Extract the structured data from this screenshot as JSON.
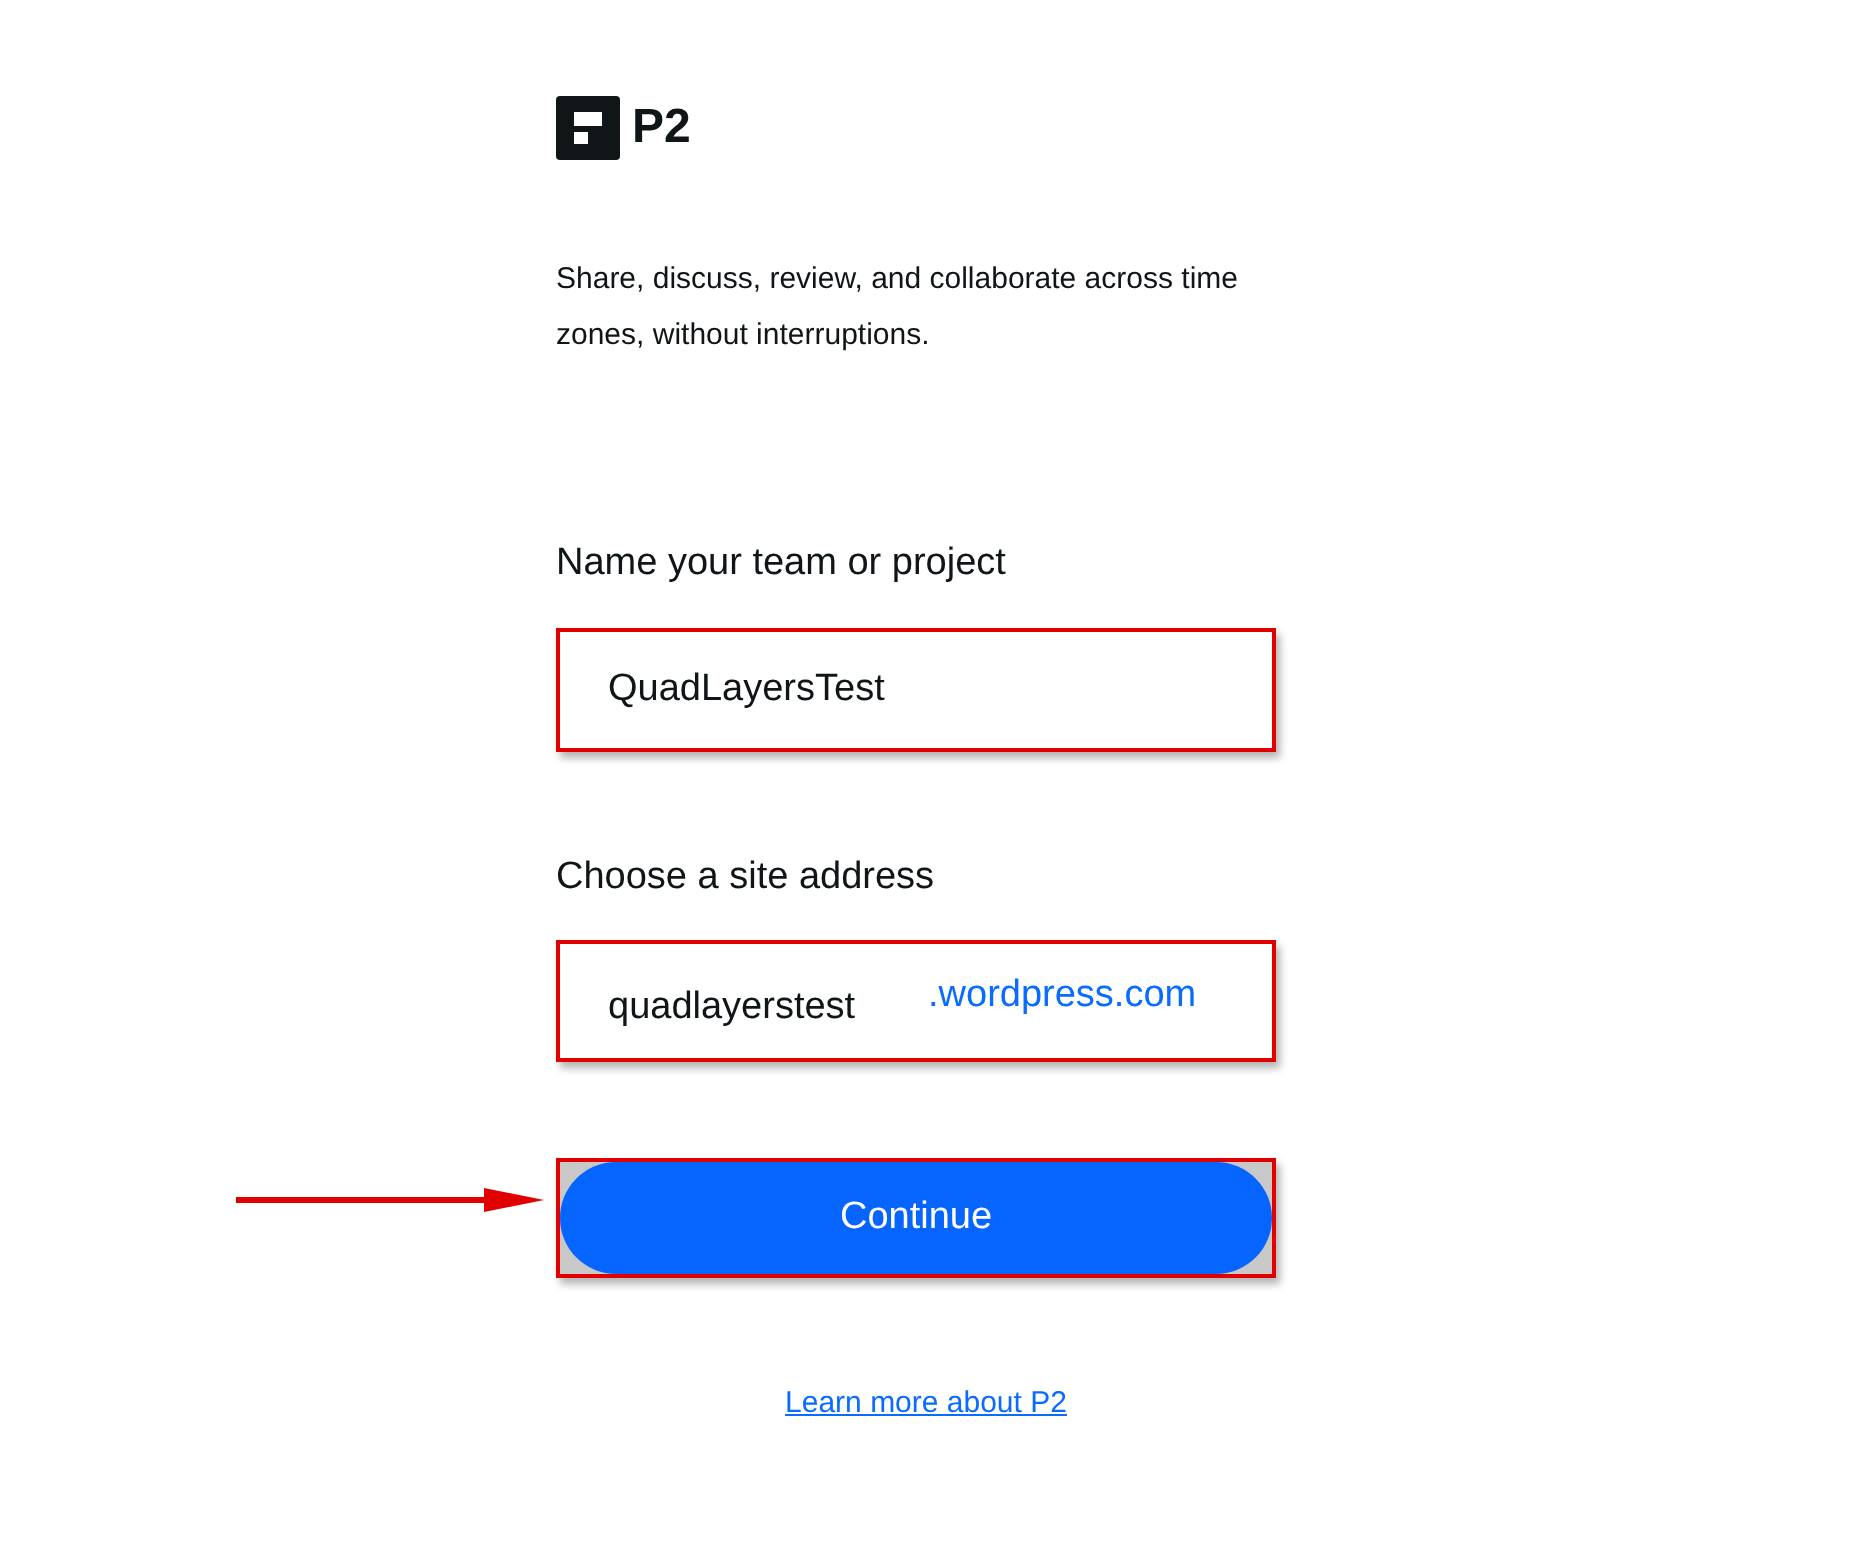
{
  "logo": {
    "text": "P2"
  },
  "tagline": "Share, discuss, review, and collaborate across time zones, without interruptions.",
  "team_field": {
    "label": "Name your team or project",
    "value": "QuadLayersTest"
  },
  "address_field": {
    "label": "Choose a site address",
    "value": "quadlayerstest",
    "suffix": ".wordpress.com"
  },
  "continue_button": {
    "label": "Continue"
  },
  "learn_more_link": {
    "label": "Learn more about P2"
  }
}
